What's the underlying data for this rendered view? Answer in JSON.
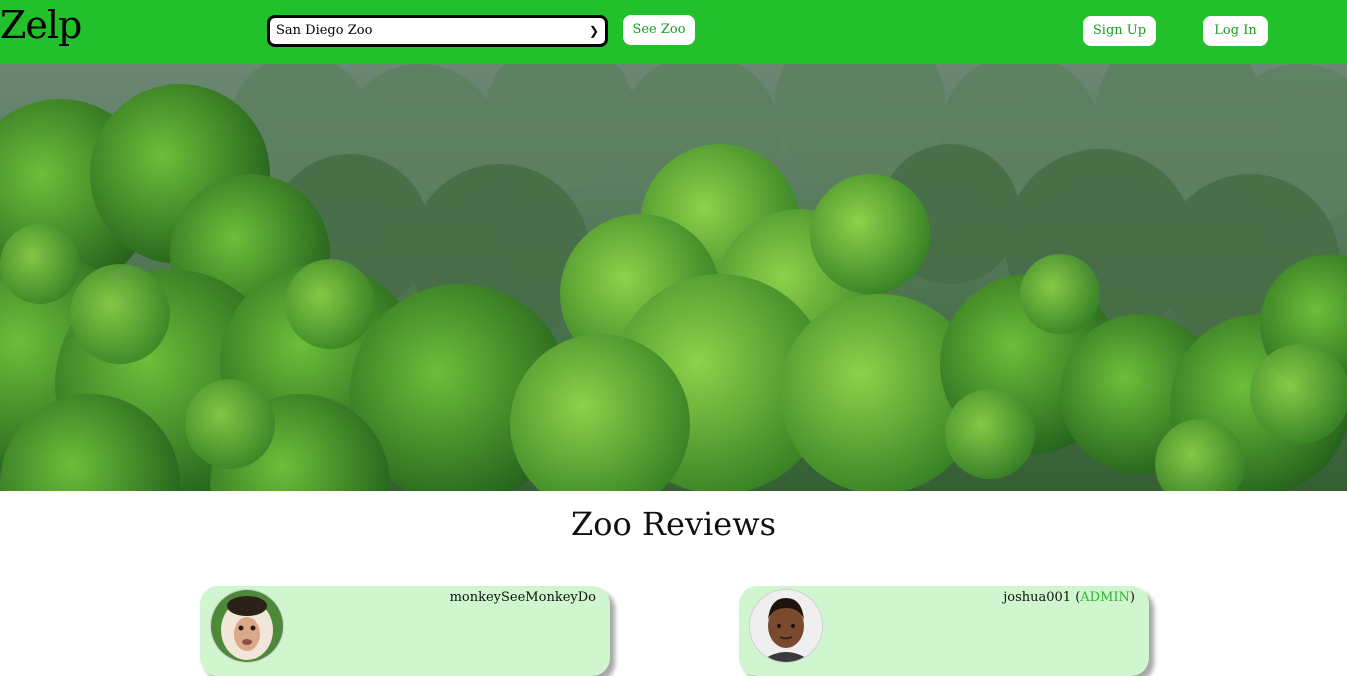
{
  "navbar": {
    "logo": "Zelp",
    "zoo_select": {
      "selected": "San Diego Zoo"
    },
    "see_zoo_label": "See Zoo",
    "sign_up_label": "Sign Up",
    "log_in_label": "Log In",
    "accent_color": "#22c02a"
  },
  "hero": {
    "image_subject": "jungle-foliage"
  },
  "reviews_section": {
    "title": "Zoo Reviews",
    "reviews": [
      {
        "username": "monkeySeeMonkeyDo",
        "avatar_icon": "capuchin-monkey-avatar"
      },
      {
        "username": "joshua001",
        "role_open": " (",
        "role": "ADMIN",
        "role_close": ")",
        "avatar_icon": "man-avatar"
      }
    ]
  }
}
